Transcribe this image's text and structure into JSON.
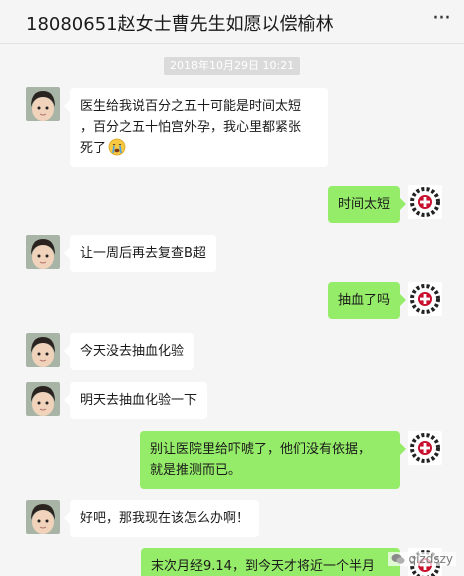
{
  "window": {
    "title": "18080651赵女士曹先生如愿以偿榆林",
    "more_icon": "ellipsis-icon"
  },
  "chat": {
    "timestamp": "2018年10月29日 10:21",
    "messages": [
      {
        "side": "left",
        "text_lines": [
          "医生给我说百分之五十可能是时间太短",
          "，百分之五十怕宫外孕，我心里都紧张",
          "死了"
        ],
        "emoji": "crying-face-icon"
      },
      {
        "side": "right",
        "text": "时间太短"
      },
      {
        "side": "left",
        "text": "让一周后再去复查B超"
      },
      {
        "side": "right",
        "text": "抽血了吗"
      },
      {
        "side": "left",
        "text": "今天没去抽血化验"
      },
      {
        "side": "left",
        "text": "明天去抽血化验一下"
      },
      {
        "side": "right",
        "text_lines": [
          "别让医院里给吓唬了，他们没有依据，",
          "就是推测而已。"
        ]
      },
      {
        "side": "left",
        "text": "好吧，那我现在该怎么办啊！"
      },
      {
        "side": "right",
        "text": "末次月经9.14，到今天才将近一个半月"
      }
    ]
  },
  "watermark": "qizdszy",
  "colors": {
    "background": "#f5f5f5",
    "left_bubble": "#ffffff",
    "right_bubble": "#95ec69",
    "timestamp_bg": "#dadada",
    "clinic_logo_red": "#c8102e"
  }
}
